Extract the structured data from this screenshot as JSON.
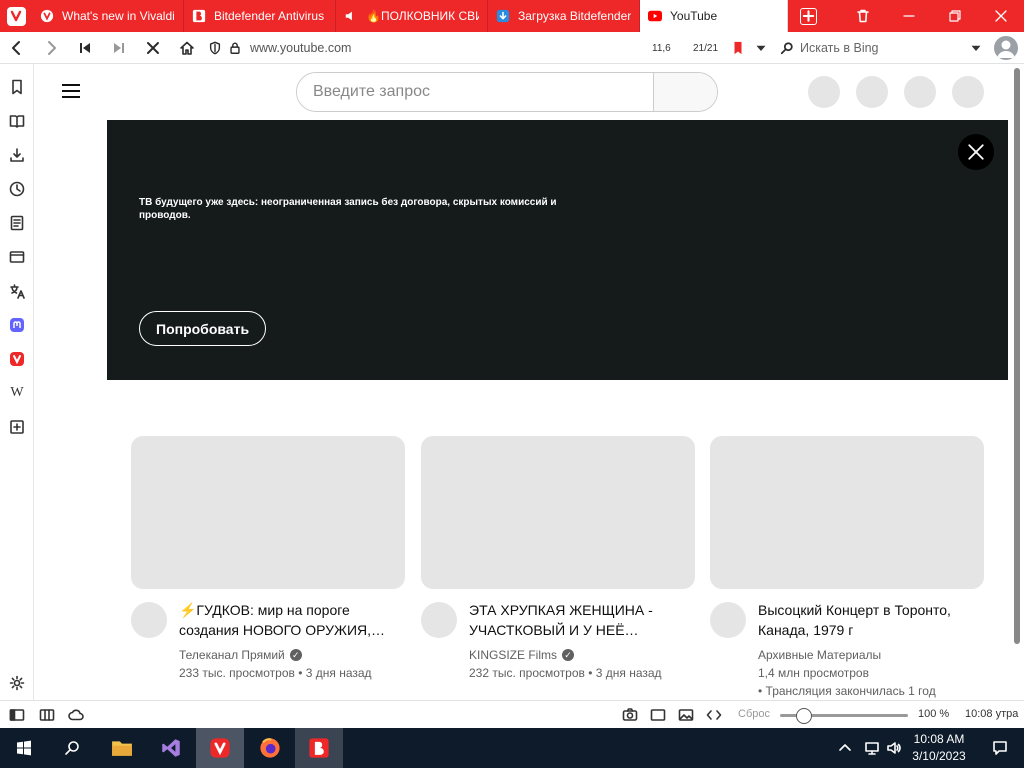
{
  "browser": {
    "tabs": [
      {
        "label": "What's new in Vivaldi",
        "favicon": "vivaldi-icon"
      },
      {
        "label": "Bitdefender Antivirus",
        "favicon": "bitdefender-icon"
      },
      {
        "label": "🔥ПОЛКОВНИК СВИ",
        "favicon": "speaker-icon"
      },
      {
        "label": "Загрузка Bitdefender",
        "favicon": "download-icon"
      },
      {
        "label": "YouTube",
        "favicon": "youtube-icon",
        "active": true
      }
    ],
    "url": "www.youtube.com",
    "status_left": "11,6",
    "status_right": "21/21",
    "search_placeholder": "Искать в Bing",
    "accent": "#ee2728"
  },
  "youtube": {
    "search_placeholder": "Введите запрос",
    "banner": {
      "text": "ТВ будущего уже здесь: неограниченная запись без договора, скрытых комиссий и проводов.",
      "cta": "Попробовать"
    },
    "videos": [
      {
        "title": "⚡ГУДКОВ: мир на пороге создания НОВОГО ОРУЖИЯ,…",
        "channel": "Телеканал Прямий",
        "verified": true,
        "views": "233 тыс. просмотров",
        "age": "3 дня назад"
      },
      {
        "title": "ЭТА ХРУПКАЯ ЖЕНЩИНА - УЧАСТКОВЫЙ И У НЕЁ…",
        "channel": "KINGSIZE Films",
        "verified": true,
        "views": "232 тыс. просмотров",
        "age": "3 дня назад"
      },
      {
        "title": "Высоцкий Концерт в Торонто, Канада, 1979 г",
        "channel": "Архивные Материалы",
        "verified": false,
        "views": "1,4 млн просмотров",
        "age": "Трансляция закончилась 1 год"
      }
    ]
  },
  "statusbar": {
    "reset_label": "Сброс",
    "zoom": "100 %",
    "time": "10:08 утра"
  },
  "taskbar": {
    "time": "10:08 AM",
    "date": "3/10/2023"
  }
}
